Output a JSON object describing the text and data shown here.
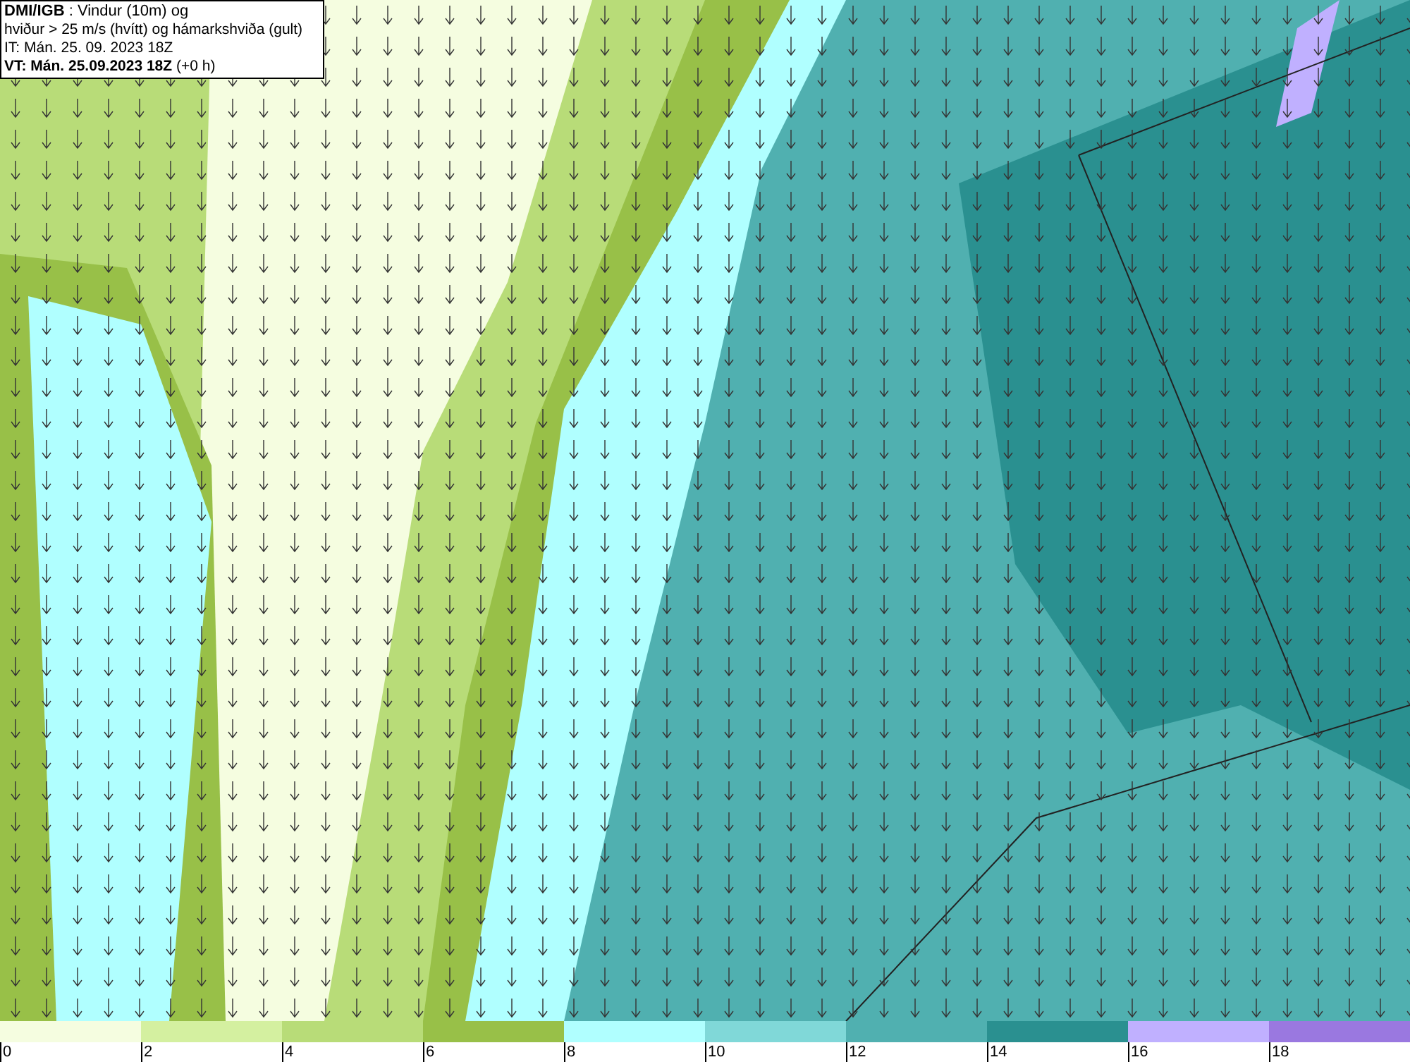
{
  "header": {
    "lines": [
      "**DMI/IGB** : Vindur (10m) og",
      "hviður > 25 m/s (hvítt) og hámarkshviða (gult)",
      "IT: Mán. 25. 09. 2023 18Z",
      "**VT: Mán. 25.09.2023 18Z** (+0 h)"
    ]
  },
  "legend": {
    "bins": [
      {
        "color": "#f5fde0"
      },
      {
        "color": "#d4f0a0"
      },
      {
        "color": "#b8dc78"
      },
      {
        "color": "#98c048"
      },
      {
        "color": "#b0ffff"
      },
      {
        "color": "#80d8d8"
      },
      {
        "color": "#50b0b0"
      },
      {
        "color": "#2a9090"
      },
      {
        "color": "#c0b0ff"
      },
      {
        "color": "#9a78e0"
      }
    ],
    "labels": [
      "0",
      "2",
      "4",
      "6",
      "8",
      "10",
      "12",
      "14",
      "16",
      "18"
    ]
  }
}
